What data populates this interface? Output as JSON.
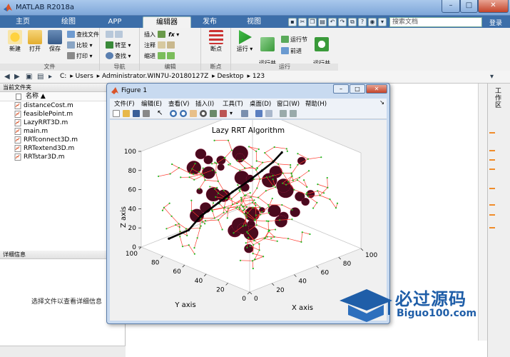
{
  "window": {
    "title": "MATLAB R2018a",
    "min": "–",
    "max": "□",
    "close": "✕"
  },
  "tabs": [
    {
      "label": "主页"
    },
    {
      "label": "绘图"
    },
    {
      "label": "APP"
    },
    {
      "label": "编辑器",
      "active": true
    },
    {
      "label": "发布"
    },
    {
      "label": "视图"
    }
  ],
  "search": {
    "placeholder": "搜索文档"
  },
  "login": "登录",
  "ribbon": {
    "file": {
      "caption": "文件",
      "new": "新建",
      "open": "打开",
      "save": "保存",
      "find_files": "查找文件",
      "compare": "比较",
      "print": "打印"
    },
    "navigate": {
      "caption": "导航",
      "goto": "转至",
      "find": "查找"
    },
    "edit": {
      "caption": "编辑",
      "insert": "插入",
      "comment": "注释",
      "indent": "缩进",
      "fx": "fx"
    },
    "breakpoints": {
      "caption": "断点",
      "label": "断点"
    },
    "run": {
      "caption": "运行",
      "run": "运行",
      "run_advance": "运行并\n前进",
      "run_section": "运行节",
      "advance": "前进",
      "run_time": "运行并\n计时"
    }
  },
  "path": {
    "crumbs": [
      "C:",
      "Users",
      "Administrator.WIN7U-20180127Z",
      "Desktop",
      "123"
    ]
  },
  "filebrowser": {
    "title": "当前文件夹",
    "column": "名称 ▲",
    "files": [
      "distanceCost.m",
      "feasiblePoint.m",
      "LazyRRT3D.m",
      "main.m",
      "RRTconnect3D.m",
      "RRTextend3D.m",
      "RRTstar3D.m"
    ]
  },
  "details": {
    "title": "详细信息",
    "message": "选择文件以查看详细信息"
  },
  "right_panel": {
    "label": "工作区"
  },
  "figure": {
    "title": "Figure 1",
    "menu": [
      "文件(F)",
      "编辑(E)",
      "查看(V)",
      "插入(I)",
      "工具(T)",
      "桌面(D)",
      "窗口(W)",
      "帮助(H)"
    ],
    "min": "–",
    "max": "□",
    "close": "✕"
  },
  "chart_data": {
    "type": "scatter",
    "projection": "3d",
    "title": "Lazy RRT Algorithm",
    "xlabel": "X axis",
    "ylabel": "Y axis",
    "zlabel": "Z axis",
    "xlim": [
      0,
      100
    ],
    "ylim": [
      0,
      100
    ],
    "zlim": [
      0,
      100
    ],
    "xticks": [
      0,
      20,
      40,
      60,
      80,
      100
    ],
    "yticks": [
      0,
      20,
      40,
      60,
      80,
      100
    ],
    "zticks": [
      0,
      20,
      40,
      60,
      80,
      100
    ],
    "grid": false,
    "colors": {
      "tree_edges": "#ff3b2f",
      "tree_nodes": "#22bb22",
      "obstacles": "#4a0a1e",
      "path": "#000000"
    }
  },
  "watermark": {
    "text": "必过源码",
    "url": "Biguo100.com"
  }
}
